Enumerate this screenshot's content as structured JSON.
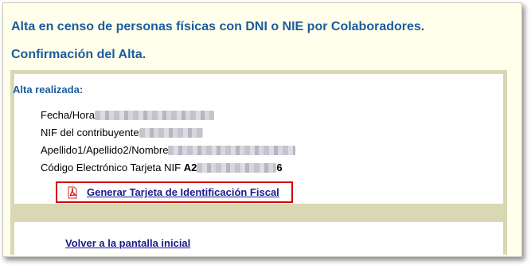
{
  "page": {
    "title": "Alta en censo de personas físicas con DNI o NIE por Colaboradores.",
    "subtitle": "Confirmación del Alta."
  },
  "result": {
    "section_title": "Alta realizada:",
    "fields": [
      {
        "label": "Fecha/Hora",
        "value_prefix": "",
        "value_suffix": ""
      },
      {
        "label": "NIF del contribuyente",
        "value_prefix": "",
        "value_suffix": ""
      },
      {
        "label": "Apellido1/Apellido2/Nombre",
        "value_prefix": "",
        "value_suffix": ""
      },
      {
        "label": "Código Electrónico Tarjeta NIF",
        "value_prefix": "A2",
        "value_suffix": "6"
      }
    ]
  },
  "actions": {
    "generate_icon": "pdf-icon",
    "generate_label": "Generar Tarjeta de Identificación Fiscal",
    "back_label": "Volver a la pantalla inicial"
  },
  "colors": {
    "heading": "#1a5c9e",
    "link": "#1a1a8c",
    "highlight_border": "#d40000",
    "panel": "#d8d8b4",
    "background": "#ffffeb"
  }
}
